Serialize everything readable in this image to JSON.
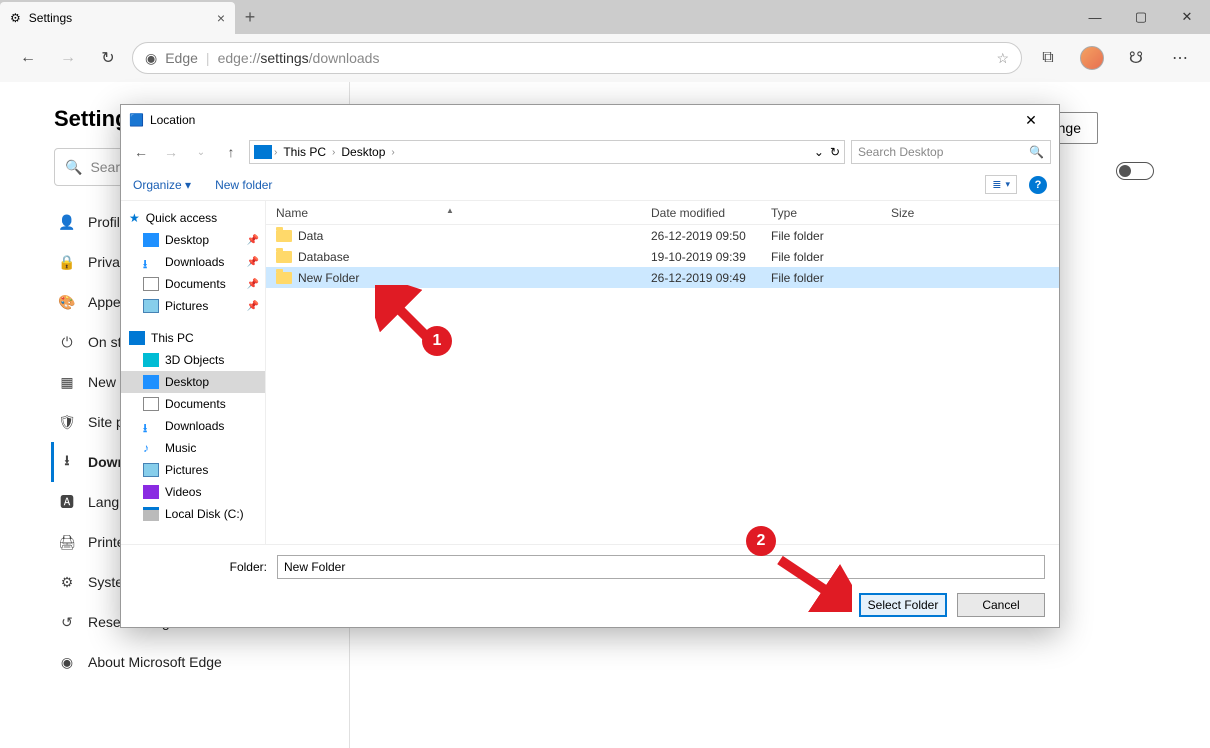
{
  "browser": {
    "tab_title": "Settings",
    "address_prefix": "Edge",
    "address_url_plain1": "edge://",
    "address_url_bold": "settings",
    "address_url_plain2": "/downloads"
  },
  "settings": {
    "title": "Settings",
    "search_placeholder": "Search settings",
    "menu": [
      {
        "icon": "profile",
        "label": "Profiles"
      },
      {
        "icon": "lock",
        "label": "Privacy and services"
      },
      {
        "icon": "palette",
        "label": "Appearance"
      },
      {
        "icon": "power",
        "label": "On startup"
      },
      {
        "icon": "tab",
        "label": "New tab page"
      },
      {
        "icon": "perm",
        "label": "Site permissions"
      },
      {
        "icon": "download",
        "label": "Downloads",
        "active": true
      },
      {
        "icon": "lang",
        "label": "Languages"
      },
      {
        "icon": "printer",
        "label": "Printers"
      },
      {
        "icon": "system",
        "label": "System"
      },
      {
        "icon": "reset",
        "label": "Reset settings"
      },
      {
        "icon": "about",
        "label": "About Microsoft Edge"
      }
    ],
    "change_button": "Change"
  },
  "dialog": {
    "title": "Location",
    "breadcrumb": [
      "This PC",
      "Desktop"
    ],
    "search_placeholder": "Search Desktop",
    "organize": "Organize",
    "newfolder": "New folder",
    "columns": {
      "name": "Name",
      "date": "Date modified",
      "type": "Type",
      "size": "Size"
    },
    "tree": {
      "quick_access": "Quick access",
      "quick_items": [
        "Desktop",
        "Downloads",
        "Documents",
        "Pictures"
      ],
      "this_pc": "This PC",
      "pc_items": [
        "3D Objects",
        "Desktop",
        "Documents",
        "Downloads",
        "Music",
        "Pictures",
        "Videos",
        "Local Disk (C:)"
      ]
    },
    "files": [
      {
        "name": "Data",
        "date": "26-12-2019 09:50",
        "type": "File folder",
        "selected": false
      },
      {
        "name": "Database",
        "date": "19-10-2019 09:39",
        "type": "File folder",
        "selected": false
      },
      {
        "name": "New Folder",
        "date": "26-12-2019 09:49",
        "type": "File folder",
        "selected": true
      }
    ],
    "folder_label": "Folder:",
    "folder_value": "New Folder",
    "select_button": "Select Folder",
    "cancel_button": "Cancel"
  },
  "annotations": {
    "c1": "1",
    "c2": "2"
  }
}
